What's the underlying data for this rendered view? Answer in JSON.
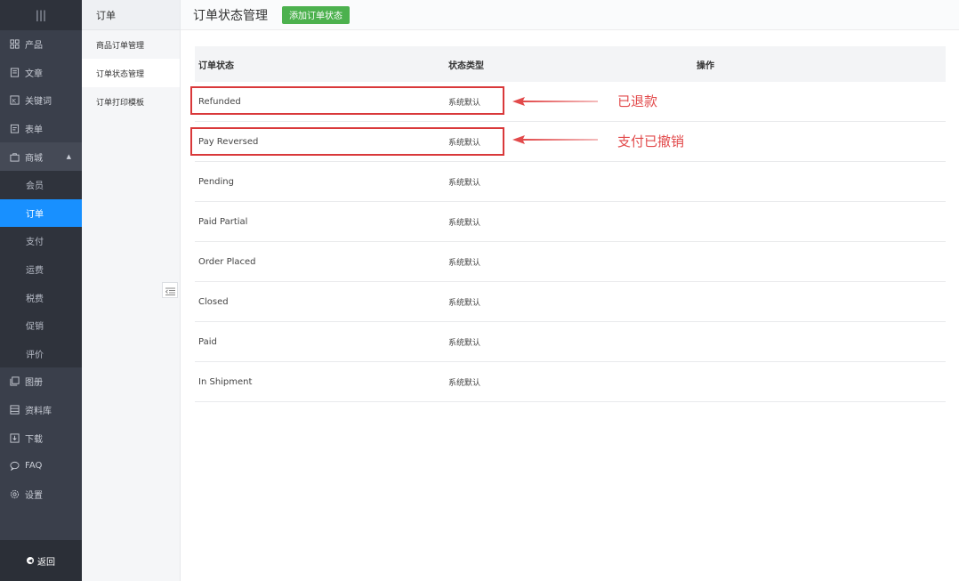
{
  "sidebar": {
    "top_glyph": "|||",
    "items": [
      {
        "label": "产品",
        "icon": "grid-icon"
      },
      {
        "label": "文章",
        "icon": "document-icon"
      },
      {
        "label": "关键词",
        "icon": "keyword-icon"
      },
      {
        "label": "表单",
        "icon": "form-icon"
      },
      {
        "label": "商城",
        "icon": "shop-icon"
      }
    ],
    "sub_items": [
      "会员",
      "订单",
      "支付",
      "运费",
      "税费",
      "促销",
      "评价"
    ],
    "after_items": [
      {
        "label": "图册",
        "icon": "gallery-icon"
      },
      {
        "label": "资料库",
        "icon": "library-icon"
      },
      {
        "label": "下载",
        "icon": "download-icon"
      },
      {
        "label": "FAQ",
        "icon": "faq-icon"
      },
      {
        "label": "设置",
        "icon": "settings-icon"
      }
    ],
    "back_label": "返回"
  },
  "submenu": {
    "title": "订单",
    "items": [
      "商品订单管理",
      "订单状态管理",
      "订单打印模板"
    ]
  },
  "header": {
    "title": "订单状态管理",
    "add_button": "添加订单状态"
  },
  "table": {
    "columns": [
      "订单状态",
      "状态类型",
      "操作"
    ],
    "rows": [
      {
        "status": "Refunded",
        "type": "系统默认"
      },
      {
        "status": "Pay Reversed",
        "type": "系统默认"
      },
      {
        "status": "Pending",
        "type": "系统默认"
      },
      {
        "status": "Paid Partial",
        "type": "系统默认"
      },
      {
        "status": "Order Placed",
        "type": "系统默认"
      },
      {
        "status": "Closed",
        "type": "系统默认"
      },
      {
        "status": "Paid",
        "type": "系统默认"
      },
      {
        "status": "In Shipment",
        "type": "系统默认"
      }
    ]
  },
  "annotations": {
    "refunded_note": "已退款",
    "reversed_note": "支付已撤销",
    "color": "#e24a4b"
  },
  "colors": {
    "sidebar_bg": "#3a3f4b",
    "active_blue": "#1890ff",
    "add_button_green": "#4cb14e"
  }
}
